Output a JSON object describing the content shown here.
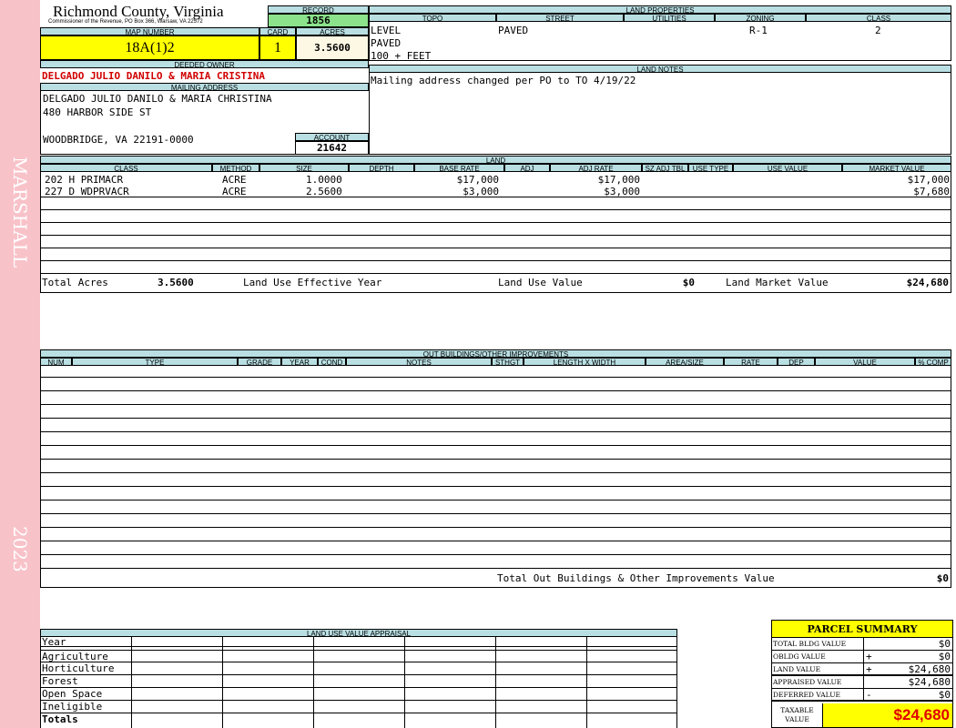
{
  "sidebar": {
    "owner_label": "MARSHALL",
    "year": "2023"
  },
  "header": {
    "county": "Richmond County, Virginia",
    "address_line": "Commissioner of the Revenue, PO Box 366, Warsaw, VA 22572",
    "record_label": "RECORD",
    "record_value": "1856",
    "map_label": "MAP NUMBER",
    "map_value": "18A(1)2",
    "card_label": "CARD",
    "card_value": "1",
    "acres_label": "ACRES",
    "acres_value": "3.5600",
    "deeded_owner_label": "DEEDED OWNER",
    "deeded_owner": "DELGADO JULIO DANILO & MARIA CRISTINA",
    "mailing_label": "MAILING ADDRESS",
    "mailing_lines": [
      "DELGADO JULIO DANILO & MARIA CHRISTINA",
      "480 HARBOR SIDE ST",
      "",
      "WOODBRIDGE, VA 22191-0000"
    ],
    "account_label": "ACCOUNT",
    "account_value": "21642"
  },
  "land_properties": {
    "title": "LAND PROPERTIES",
    "headers": [
      "TOPO",
      "STREET",
      "UTILITIES",
      "ZONING",
      "CLASS"
    ],
    "topo": [
      "LEVEL",
      "PAVED",
      "100 + FEET"
    ],
    "street": "PAVED",
    "zoning": "R-1",
    "class": "2"
  },
  "land_notes": {
    "title": "LAND NOTES",
    "text": "Mailing address changed per PO to TO 4/19/22"
  },
  "land": {
    "title": "LAND",
    "headers": [
      "CLASS",
      "METHOD",
      "SIZE",
      "DEPTH",
      "BASE RATE",
      "ADJ",
      "ADJ RATE",
      "SZ ADJ TBL",
      "USE TYPE",
      "USE VALUE",
      "MARKET VALUE"
    ],
    "rows": [
      {
        "class": "202 H PRIMACR",
        "method": "ACRE",
        "size": "1.0000",
        "base_rate": "$17,000",
        "adj_rate": "$17,000",
        "market_value": "$17,000"
      },
      {
        "class": "227 D WDPRVACR",
        "method": "ACRE",
        "size": "2.5600",
        "base_rate": "$3,000",
        "adj_rate": "$3,000",
        "market_value": "$7,680"
      }
    ],
    "total_acres_label": "Total Acres",
    "total_acres": "3.5600",
    "effective_year_label": "Land Use Effective Year",
    "land_use_value_label": "Land Use Value",
    "land_use_value": "$0",
    "land_market_value_label": "Land Market Value",
    "land_market_value": "$24,680"
  },
  "outbuildings": {
    "title": "OUT BUILDINGS/OTHER IMPROVEMENTS",
    "headers": [
      "NUM",
      "TYPE",
      "GRADE",
      "YEAR",
      "COND",
      "NOTES",
      "STHGT",
      "LENGTH X WIDTH",
      "AREA/SIZE",
      "RATE",
      "DEP",
      "VALUE",
      "% COMP"
    ],
    "total_label": "Total Out Buildings & Other Improvements Value",
    "total_value": "$0"
  },
  "land_use_appraisal": {
    "title": "LAND USE VALUE APPRAISAL",
    "rows": [
      "Year",
      "Agriculture",
      "Horticulture",
      "Forest",
      "Open Space",
      "Ineligible",
      "Totals"
    ]
  },
  "parcel_summary": {
    "title": "PARCEL SUMMARY",
    "rows": [
      {
        "label": "TOTAL BLDG VALUE",
        "op": "",
        "value": "$0"
      },
      {
        "label": "OBLDG VALUE",
        "op": "+",
        "value": "$0"
      },
      {
        "label": "LAND VALUE",
        "op": "+",
        "value": "$24,680"
      },
      {
        "label": "APPRAISED VALUE",
        "op": "",
        "value": "$24,680"
      },
      {
        "label": "DEFERRED VALUE",
        "op": "-",
        "value": "$0"
      }
    ],
    "taxable_label": "TAXABLE VALUE",
    "taxable_value": "$24,680"
  }
}
